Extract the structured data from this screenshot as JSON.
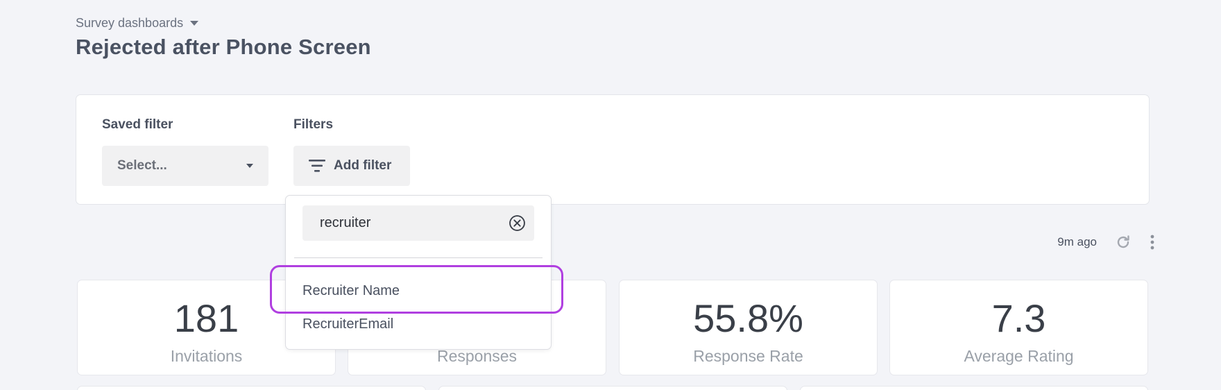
{
  "breadcrumb": {
    "label": "Survey dashboards"
  },
  "page": {
    "title": "Rejected after Phone Screen"
  },
  "filters": {
    "saved_filter_label": "Saved filter",
    "saved_filter_placeholder": "Select...",
    "filters_label": "Filters",
    "add_filter_label": "Add filter"
  },
  "dropdown": {
    "search_value": "recruiter",
    "options": [
      {
        "label": "Recruiter Name"
      },
      {
        "label": "RecruiterEmail"
      }
    ]
  },
  "toolbar": {
    "updated": "9m ago"
  },
  "stats": [
    {
      "value": "181",
      "label": "Invitations"
    },
    {
      "value": "",
      "label": "Responses"
    },
    {
      "value": "55.8%",
      "label": "Response Rate"
    },
    {
      "value": "7.3",
      "label": "Average Rating"
    }
  ],
  "colors": {
    "highlight": "#b03fe0",
    "background": "#f3f4f8"
  }
}
